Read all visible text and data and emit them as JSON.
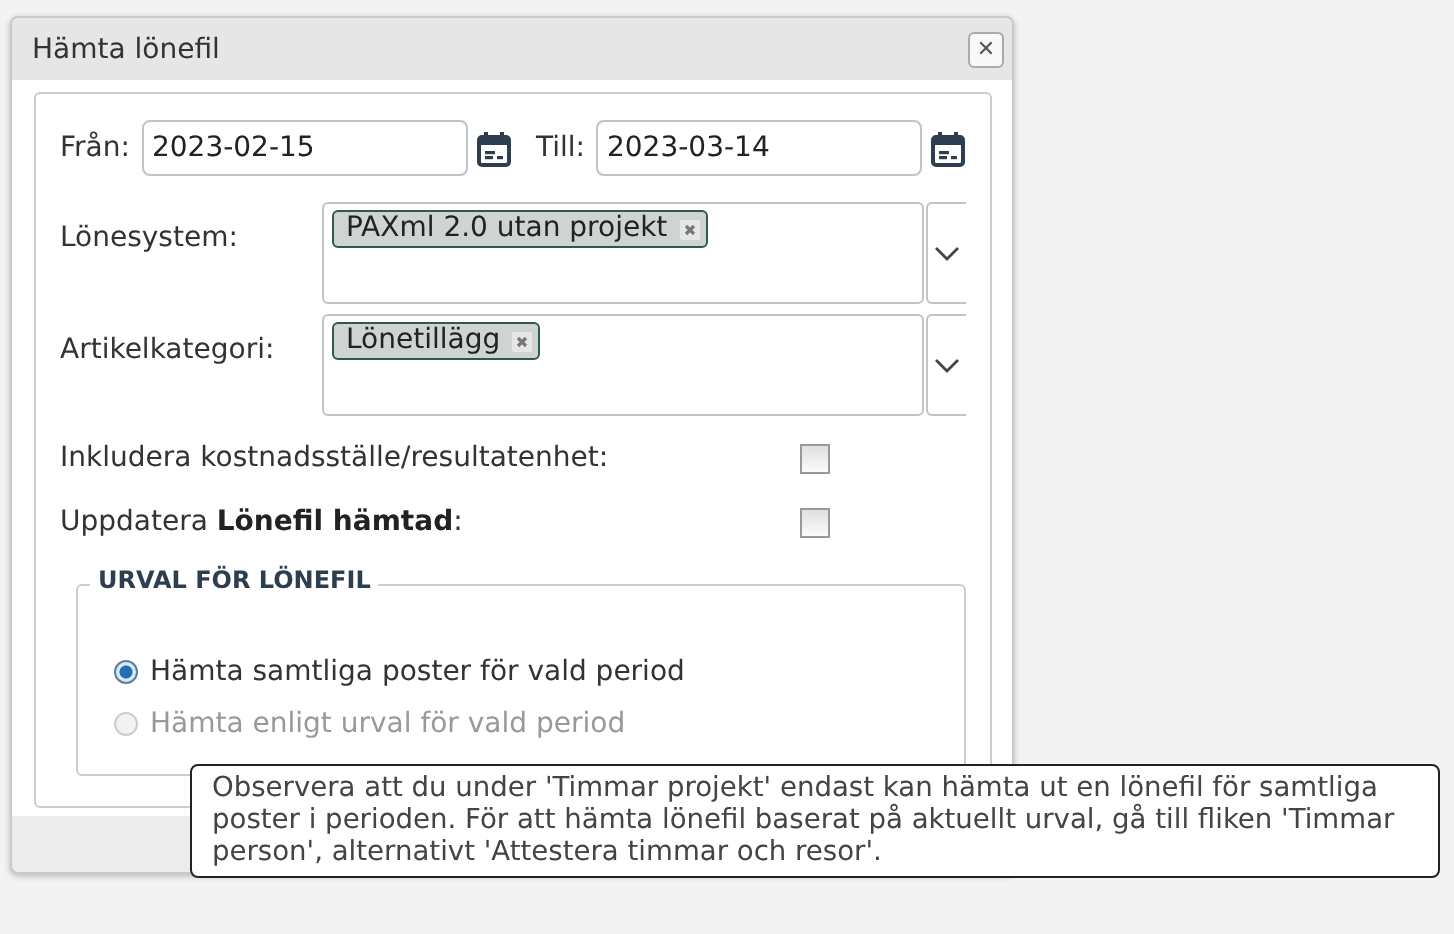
{
  "window": {
    "title": "Hämta lönefil",
    "close": "✕"
  },
  "dates": {
    "from_label": "Från:",
    "from_value": "2023-02-15",
    "to_label": "Till:",
    "to_value": "2023-03-14"
  },
  "selects": [
    {
      "label": "Lönesystem:",
      "tags": [
        "PAXml 2.0 utan projekt"
      ]
    },
    {
      "label": "Artikelkategori:",
      "tags": [
        "Lönetillägg"
      ]
    }
  ],
  "checkboxes": [
    {
      "label": "Inkludera kostnadsställe/resultatenhet:",
      "checked": false
    },
    {
      "label": "Uppdatera **Lönefil hämtad**:",
      "checked": false
    }
  ],
  "selection": {
    "legend": "URVAL FÖR LÖNEFIL",
    "options": [
      {
        "label": "Hämta samtliga poster för vald period",
        "selected": true,
        "disabled": false
      },
      {
        "label": "Hämta enligt urval för vald period",
        "selected": false,
        "disabled": true
      }
    ]
  },
  "tooltip": "Observera att du under 'Timmar projekt' endast kan hämta ut en lönefil för samtliga poster i perioden. För att hämta lönefil baserat på aktuellt urval, gå till fliken 'Timmar person', alternativt 'Attestera timmar och resor'."
}
